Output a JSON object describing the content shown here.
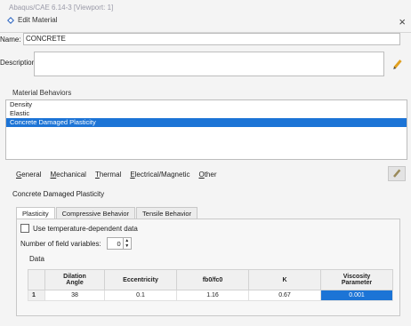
{
  "app": {
    "window_title": "Abaqus/CAE 6.14-3 [Viewport: 1]"
  },
  "dialog": {
    "title": "Edit Material",
    "close_glyph": "×"
  },
  "fields": {
    "name_label": "Name:",
    "name_value": "CONCRETE",
    "description_label": "Description:",
    "description_value": ""
  },
  "behaviors": {
    "group_label": "Material Behaviors",
    "items": [
      "Density",
      "Elastic",
      "Concrete Damaged Plasticity"
    ],
    "selected_index": 2
  },
  "menu": {
    "items": [
      {
        "underline": "G",
        "rest": "eneral"
      },
      {
        "underline": "M",
        "rest": "echanical"
      },
      {
        "underline": "T",
        "rest": "hermal"
      },
      {
        "underline": "E",
        "rest": "lectrical/Magnetic"
      },
      {
        "underline": "O",
        "rest": "ther"
      }
    ]
  },
  "section": {
    "title": "Concrete Damaged Plasticity"
  },
  "tabs": [
    "Plasticity",
    "Compressive Behavior",
    "Tensile Behavior"
  ],
  "plasticity": {
    "temp_dependent_label": "Use temperature-dependent data",
    "field_vars_label": "Number of field variables:",
    "field_vars_value": "0",
    "data_label": "Data",
    "columns": [
      [
        "Dilation",
        "Angle"
      ],
      [
        "Eccentricity",
        ""
      ],
      [
        "fb0/fc0",
        ""
      ],
      [
        "K",
        ""
      ],
      [
        "Viscosity",
        "Parameter"
      ]
    ],
    "rows": [
      {
        "index": "1",
        "cells": [
          "38",
          "0.1",
          "1.16",
          "0.67",
          "0.001"
        ],
        "selected_col": 4
      }
    ]
  },
  "colors": {
    "selection": "#1c74d6",
    "icon_accent": "#3a6fc4",
    "pencil": "#e0a020"
  },
  "icons": [
    "abaqus-diamond-icon",
    "close-icon",
    "pencil-icon",
    "spin-arrows-icon"
  ]
}
